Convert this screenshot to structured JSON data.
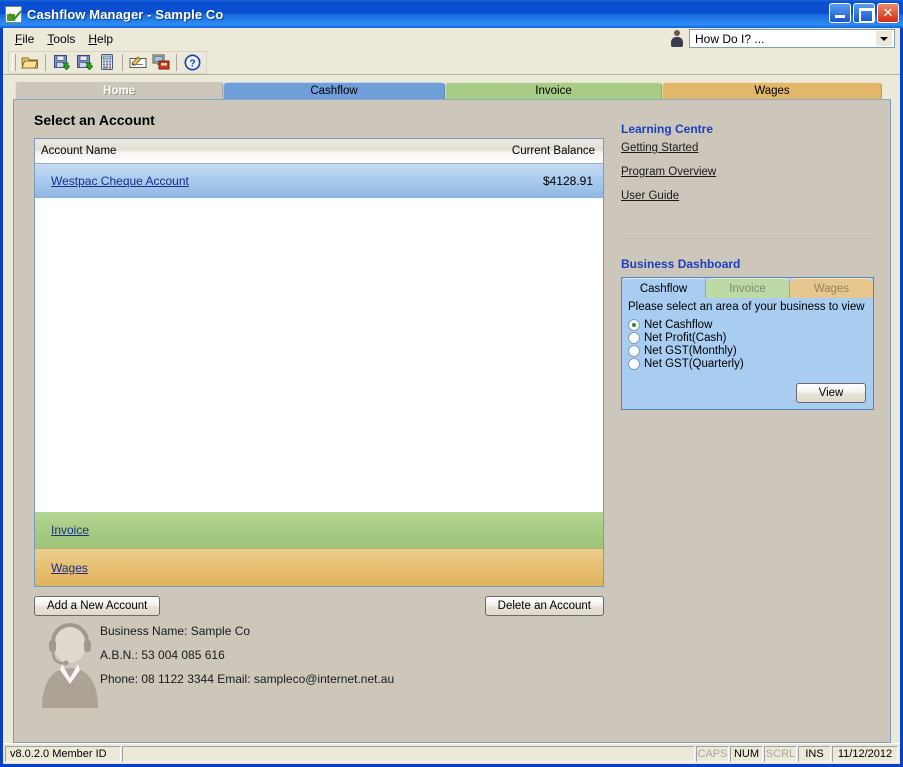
{
  "window": {
    "title": "Cashflow Manager  -  Sample Co",
    "app_icon": "cashflow-leaf-icon",
    "minimize_label": "_",
    "maximize_label": "□",
    "close_label": "✕"
  },
  "menubar": {
    "items": [
      {
        "name": "file",
        "accel": "F",
        "rest": "ile"
      },
      {
        "name": "tools",
        "accel": "T",
        "rest": "ools"
      },
      {
        "name": "help",
        "accel": "H",
        "rest": "elp"
      }
    ],
    "howdoi": {
      "value": "How Do I? ...",
      "icon": "person-icon",
      "arrow": "chevron-down-icon"
    }
  },
  "toolbar": {
    "buttons": [
      {
        "name": "open-folder-icon",
        "title": "Open"
      },
      {
        "name": "save-import-icon",
        "title": "Save / Import"
      },
      {
        "name": "save-export-icon",
        "title": "Save / Export"
      },
      {
        "name": "calculator-icon",
        "title": "Calculator"
      },
      {
        "name": "cheque-write-icon",
        "title": "Write Cheque"
      },
      {
        "name": "print-network-icon",
        "title": "Print"
      },
      {
        "name": "help-icon",
        "title": "Help"
      }
    ]
  },
  "tabs": [
    {
      "label": "Home",
      "key": "home",
      "active": true
    },
    {
      "label": "Cashflow",
      "key": "cash",
      "active": false
    },
    {
      "label": "Invoice",
      "key": "inv",
      "active": false
    },
    {
      "label": "Wages",
      "key": "wag",
      "active": false
    }
  ],
  "main": {
    "heading": "Select an Account",
    "table": {
      "columns": [
        "Account Name",
        "Current Balance"
      ],
      "rows": [
        {
          "name": "Westpac Cheque Account",
          "balance": "$4128.91",
          "selected": true
        }
      ]
    },
    "strips": [
      {
        "key": "invoice",
        "label": "Invoice"
      },
      {
        "key": "wages",
        "label": "Wages"
      }
    ],
    "buttons": {
      "add": "Add a New Account",
      "delete": "Delete an Account"
    },
    "business": {
      "name_line": "Business Name: Sample Co",
      "abn_line": "A.B.N.: 53 004 085 616",
      "contact_line": "Phone: 08 1122 3344 Email: sampleco@internet.net.au",
      "avatar": "support-agent-headset-icon"
    }
  },
  "sidebar": {
    "learning": {
      "title": "Learning Centre",
      "links": [
        "Getting Started",
        "Program Overview",
        "User Guide"
      ]
    },
    "dashboard": {
      "title": "Business Dashboard",
      "tabs": [
        {
          "label": "Cashflow",
          "key": "active",
          "active": true
        },
        {
          "label": "Invoice",
          "key": "inv",
          "active": false
        },
        {
          "label": "Wages",
          "key": "wag",
          "active": false
        }
      ],
      "prompt": "Please select an area of your business to view",
      "options": [
        {
          "label": "Net Cashflow",
          "checked": true
        },
        {
          "label": "Net Profit(Cash)",
          "checked": false
        },
        {
          "label": "Net GST(Monthly)",
          "checked": false
        },
        {
          "label": "Net GST(Quarterly)",
          "checked": false
        }
      ],
      "view_button": "View"
    }
  },
  "statusbar": {
    "version": "v8.0.2.0 Member ID",
    "indicators": [
      {
        "label": "CAPS",
        "on": false
      },
      {
        "label": "NUM",
        "on": true
      },
      {
        "label": "SCRL",
        "on": false
      },
      {
        "label": "INS",
        "on": true
      }
    ],
    "date": "11/12/2012"
  },
  "colors": {
    "titlebar_blue": "#0a4fd0",
    "tab_cashflow": "#6f9ed8",
    "tab_invoice": "#a8cc86",
    "tab_wages": "#e3b76a",
    "selected_row": "#aecdee",
    "link_blue": "#1b2e8c",
    "heading_blue": "#1b3fbf",
    "panel_bg": "#cdc7bb",
    "dashboard_bg": "#a8cdf0"
  }
}
